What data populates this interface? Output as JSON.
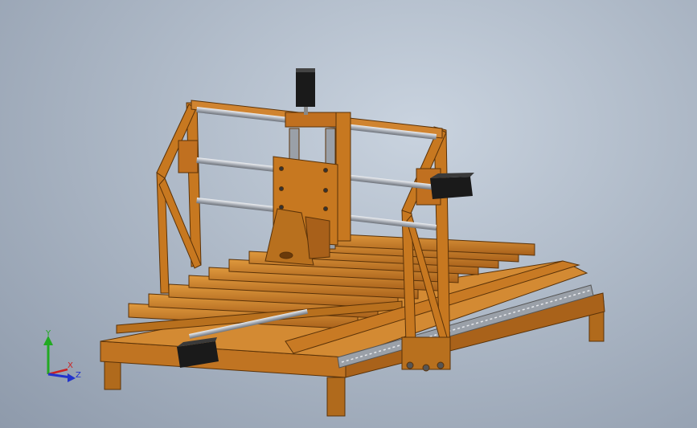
{
  "viewport": {
    "background": "#aeb9c7"
  },
  "model": {
    "material_color": "#c8781e",
    "material_shadow": "#8a4e10",
    "material_light": "#e09a3e",
    "rod_color": "#b8bcc4",
    "motor_color": "#1a1a1a",
    "plate_color": "#c77820",
    "rail_color": "#9aa0a8"
  },
  "triad": {
    "y_label": "Y",
    "x_label": "X",
    "z_label": "Z",
    "y_color": "#22aa22",
    "x_color": "#cc2222",
    "z_color": "#2233cc"
  }
}
